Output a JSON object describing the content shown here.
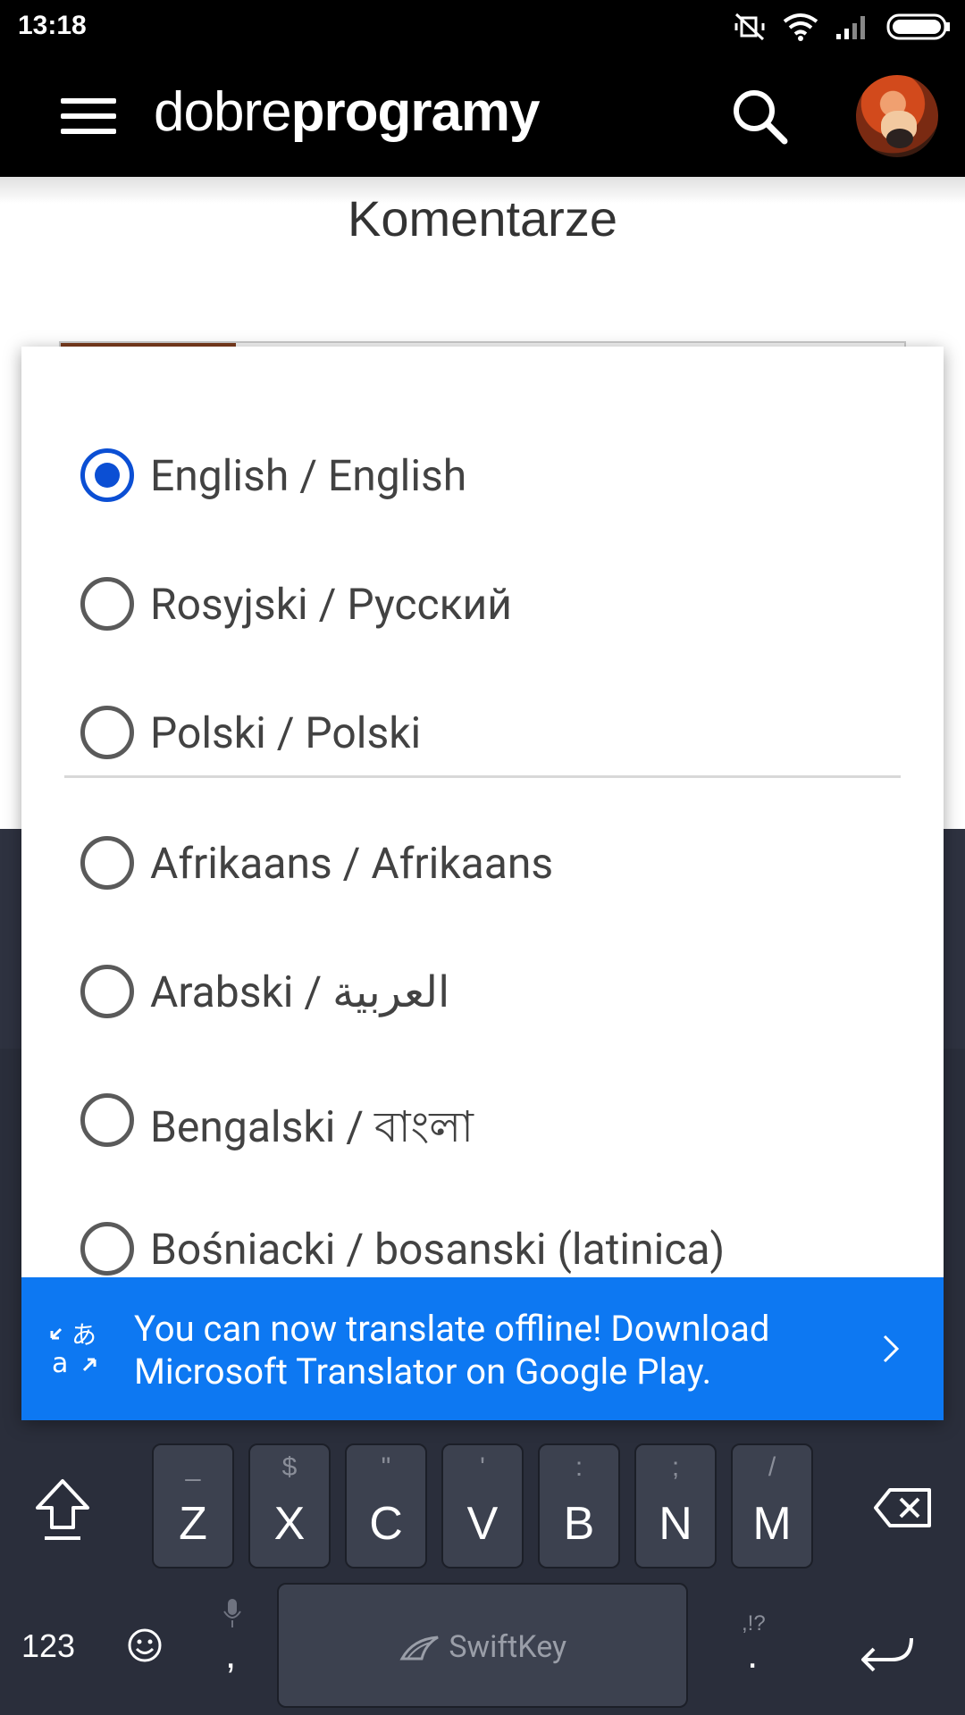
{
  "status_bar": {
    "time": "13:18"
  },
  "header": {
    "logo_light": "dobre",
    "logo_bold": "programy"
  },
  "page": {
    "title": "Komentarze"
  },
  "language_dialog": {
    "items": [
      {
        "label": "English / English",
        "selected": true
      },
      {
        "label": "Rosyjski / Русский",
        "selected": false
      },
      {
        "label": "Polski / Polski",
        "selected": false
      },
      {
        "label": "Afrikaans / Afrikaans",
        "selected": false
      },
      {
        "label": "Arabski / العربية",
        "selected": false
      },
      {
        "label": "Bengalski / বাংলা",
        "selected": false
      },
      {
        "label": "Bośniacki / bosanski (latinica)",
        "selected": false
      }
    ],
    "banner": {
      "text": "You can now translate offline! Download Microsoft Translator on Google Play.",
      "icon": "translate-icon"
    },
    "colors": {
      "selected_radio": "#0b4fd4",
      "banner_bg": "#0d78f2"
    }
  },
  "keyboard": {
    "bottom_row": [
      {
        "main": "Z",
        "alt": "_"
      },
      {
        "main": "X",
        "alt": "$"
      },
      {
        "main": "C",
        "alt": "\""
      },
      {
        "main": "V",
        "alt": "'"
      },
      {
        "main": "B",
        "alt": ":"
      },
      {
        "main": "N",
        "alt": ";"
      },
      {
        "main": "M",
        "alt": "/"
      }
    ],
    "numbers_label": "123",
    "comma": ",",
    "space_label": "SwiftKey",
    "period": ".",
    "punct_hint": ",!?"
  }
}
